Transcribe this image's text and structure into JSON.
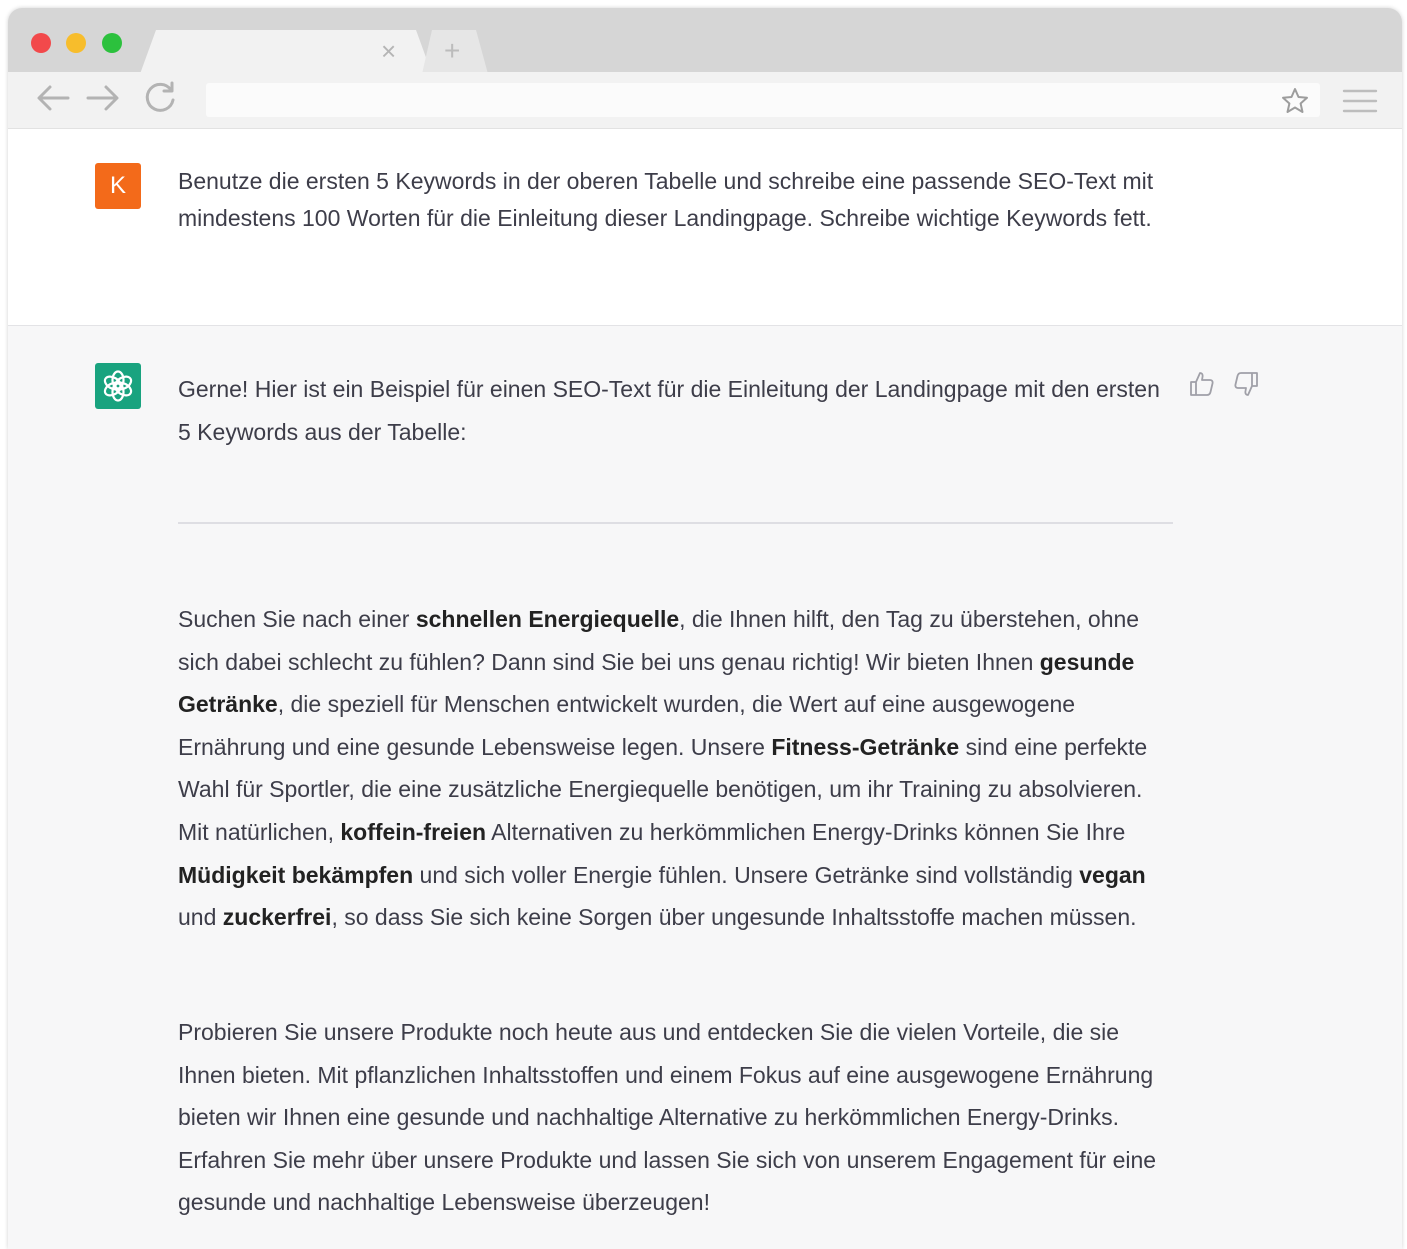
{
  "browser": {
    "tab_close_glyph": "×",
    "new_tab_glyph": "+",
    "address_value": ""
  },
  "user_message": {
    "avatar_letter": "K",
    "avatar_color": "#f36a1a",
    "text": "Benutze die ersten 5 Keywords in der oberen Tabelle und schreibe eine passende SEO-Text mit mindestens 100 Worten für die Einleitung dieser Landingpage. Schreibe wichtige Keywords fett."
  },
  "assistant_message": {
    "avatar_color": "#19a37f",
    "avatar_icon": "openai-logo-icon",
    "intro": "Gerne! Hier ist ein Beispiel für einen SEO-Text für die Einleitung der Landingpage mit den ersten 5 Keywords aus der Tabelle:",
    "paragraph1": [
      {
        "t": "Suchen Sie nach einer ",
        "b": false
      },
      {
        "t": "schnellen Energiequelle",
        "b": true
      },
      {
        "t": ", die Ihnen hilft, den Tag zu überstehen, ohne sich dabei schlecht zu fühlen? Dann sind Sie bei uns genau richtig! Wir bieten Ihnen ",
        "b": false
      },
      {
        "t": "gesunde Getränke",
        "b": true
      },
      {
        "t": ", die speziell für Menschen entwickelt wurden, die Wert auf eine ausgewogene Ernährung und eine gesunde Lebensweise legen. Unsere ",
        "b": false
      },
      {
        "t": "Fitness-Getränke",
        "b": true
      },
      {
        "t": " sind eine perfekte Wahl für Sportler, die eine zusätzliche Energiequelle benötigen, um ihr Training zu absolvieren. Mit natürlichen, ",
        "b": false
      },
      {
        "t": "koffein-freien",
        "b": true
      },
      {
        "t": " Alternativen zu herkömmlichen Energy-Drinks können Sie Ihre ",
        "b": false
      },
      {
        "t": "Müdigkeit bekämpfen",
        "b": true
      },
      {
        "t": " und sich voller Energie fühlen. Unsere Getränke sind vollständig ",
        "b": false
      },
      {
        "t": "vegan",
        "b": true
      },
      {
        "t": " und ",
        "b": false
      },
      {
        "t": "zuckerfrei",
        "b": true
      },
      {
        "t": ", so dass Sie sich keine Sorgen über ungesunde Inhaltsstoffe machen müssen.",
        "b": false
      }
    ],
    "paragraph2": "Probieren Sie unsere Produkte noch heute aus und entdecken Sie die vielen Vorteile, die sie Ihnen bieten. Mit pflanzlichen Inhaltsstoffen und einem Fokus auf eine ausgewogene Ernährung bieten wir Ihnen eine gesunde und nachhaltige Alternative zu herkömmlichen Energy-Drinks. Erfahren Sie mehr über unsere Produkte und lassen Sie sich von unserem Engagement für eine gesunde und nachhaltige Lebensweise überzeugen!"
  }
}
